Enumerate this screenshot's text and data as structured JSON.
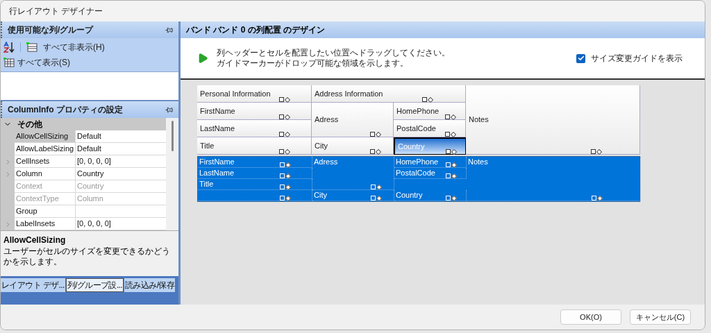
{
  "window": {
    "title": "行レイアウト デザイナー"
  },
  "columns_panel": {
    "title": "使用可能な列/グループ",
    "toolbar": [
      {
        "kind": "sort"
      },
      {
        "kind": "hide",
        "label": "すべて非表示(H)"
      },
      {
        "kind": "show",
        "label": "すべて表示(S)"
      }
    ]
  },
  "properties_panel": {
    "title": "ColumnInfo プロパティの設定",
    "category": {
      "label": "その他",
      "expanded": true
    },
    "rows": [
      {
        "name": "AllowCellSizing",
        "value": "Default",
        "selected": true,
        "expandable": false,
        "disabled": false
      },
      {
        "name": "AllowLabelSizing",
        "value": "Default",
        "selected": false,
        "expandable": false,
        "disabled": false
      },
      {
        "name": "CellInsets",
        "value": "[0, 0, 0, 0]",
        "selected": false,
        "expandable": true,
        "disabled": false
      },
      {
        "name": "Column",
        "value": "Country",
        "selected": false,
        "expandable": true,
        "disabled": false
      },
      {
        "name": "Context",
        "value": "Country",
        "selected": false,
        "expandable": false,
        "disabled": true
      },
      {
        "name": "ContextType",
        "value": "Column",
        "selected": false,
        "expandable": false,
        "disabled": true
      },
      {
        "name": "Group",
        "value": "",
        "selected": false,
        "expandable": false,
        "disabled": false
      },
      {
        "name": "LabelInsets",
        "value": "[0, 0, 0, 0]",
        "selected": false,
        "expandable": true,
        "disabled": false
      }
    ],
    "help": {
      "title": "AllowCellSizing",
      "text": "ユーザーがセルのサイズを変更できるかどうかを示します。"
    }
  },
  "bottom_tabs": [
    {
      "label": "レイアウト デザ...",
      "selected": false
    },
    {
      "label": "列/グループ設...",
      "selected": true
    },
    {
      "label": "読み込み/保存",
      "selected": false
    }
  ],
  "designer": {
    "title": "バンド バンド 0 の列配置 のデザイン",
    "instructions": [
      "列ヘッダーとセルを配置したい位置へドラッグしてください。",
      "ガイドマーカーがドロップ可能な領域を示します。"
    ],
    "guide_checkbox": {
      "label": "サイズ変更ガイドを表示",
      "checked": true
    },
    "header_cells": [
      {
        "text": "Personal Information",
        "selected": false
      },
      {
        "text": "Address Information",
        "selected": false
      },
      {
        "text": "Notes",
        "selected": false
      },
      {
        "text": "FirstName",
        "selected": false
      },
      {
        "text": "Adress",
        "selected": false
      },
      {
        "text": "HomePhone",
        "selected": false
      },
      {
        "text": "LastName",
        "selected": false
      },
      {
        "text": "PostalCode",
        "selected": false
      },
      {
        "text": "Title",
        "selected": false
      },
      {
        "text": "City",
        "selected": false
      },
      {
        "text": "Country",
        "selected": true
      }
    ],
    "body_cells": [
      {
        "text": "FirstName"
      },
      {
        "text": "Adress"
      },
      {
        "text": "HomePhone"
      },
      {
        "text": "Notes"
      },
      {
        "text": "LastName"
      },
      {
        "text": "PostalCode"
      },
      {
        "text": "Title"
      },
      {
        "text": "City"
      },
      {
        "text": "Country"
      }
    ]
  },
  "buttons": [
    {
      "label": "OK(O)"
    },
    {
      "label": "キャンセル(C)"
    }
  ]
}
